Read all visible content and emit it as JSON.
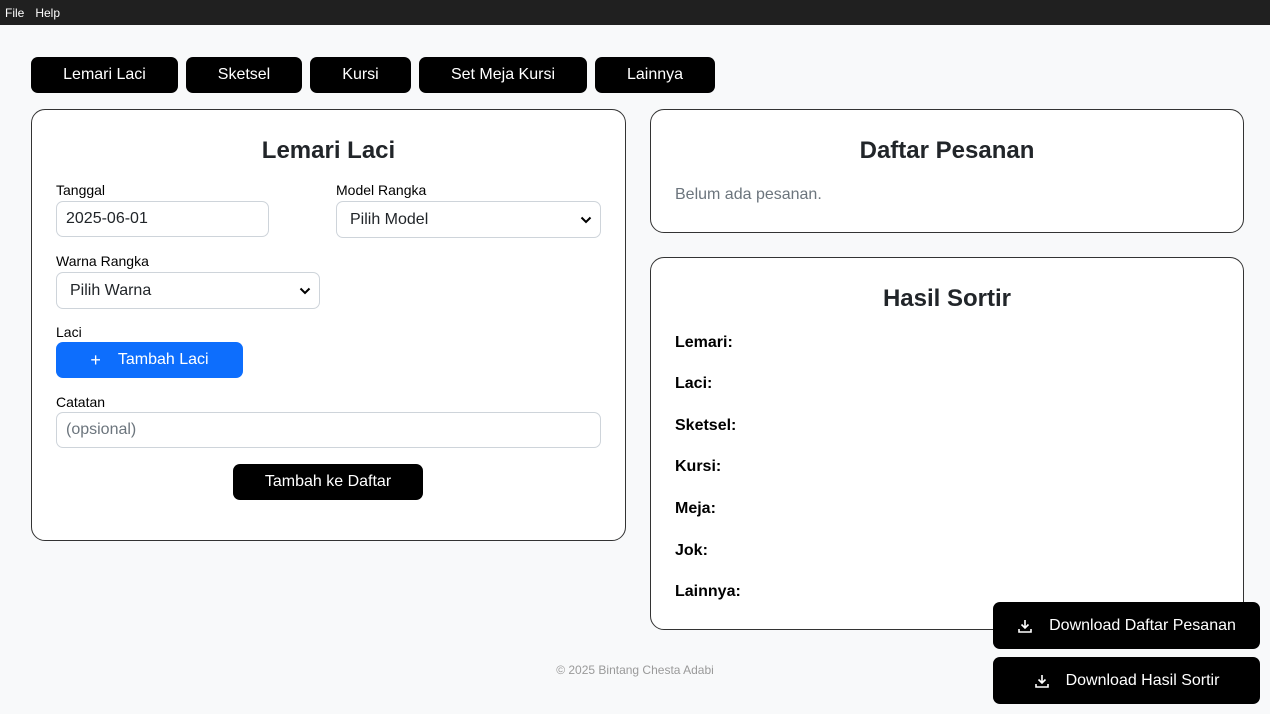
{
  "menubar": {
    "items": [
      "File",
      "Help"
    ]
  },
  "tabs": [
    {
      "label": "Lemari Laci"
    },
    {
      "label": "Sketsel"
    },
    {
      "label": "Kursi"
    },
    {
      "label": "Set Meja Kursi"
    },
    {
      "label": "Lainnya"
    }
  ],
  "form": {
    "title": "Lemari Laci",
    "tanggal_label": "Tanggal",
    "tanggal_value": "2025-06-01",
    "model_label": "Model Rangka",
    "model_value": "Pilih Model",
    "warna_label": "Warna Rangka",
    "warna_value": "Pilih Warna",
    "laci_label": "Laci",
    "add_laci_label": "Tambah Laci",
    "catatan_label": "Catatan",
    "catatan_placeholder": "(opsional)",
    "submit_label": "Tambah ke Daftar"
  },
  "orders": {
    "title": "Daftar Pesanan",
    "empty_text": "Belum ada pesanan."
  },
  "sorted": {
    "title": "Hasil Sortir",
    "rows": [
      "Lemari:",
      "Laci:",
      "Sketsel:",
      "Kursi:",
      "Meja:",
      "Jok:",
      "Lainnya:"
    ]
  },
  "downloads": {
    "orders_label": "Download Daftar Pesanan",
    "sorted_label": "Download Hasil Sortir"
  },
  "footer": {
    "text": "© 2025 Bintang Chesta Adabi"
  },
  "colors": {
    "accent": "#0d6efd",
    "primary_button": "#000000",
    "menubar": "#202020"
  }
}
